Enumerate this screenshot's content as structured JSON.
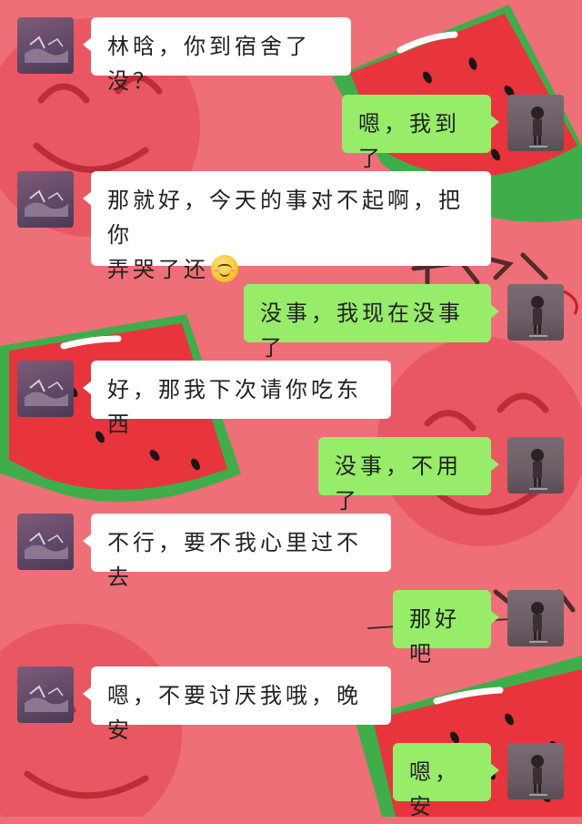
{
  "chat": {
    "messages": [
      {
        "sender": "friend",
        "text": "林晗，你到宿舍了没？"
      },
      {
        "sender": "me",
        "text": "嗯，我到了"
      },
      {
        "sender": "friend",
        "line1": "那就好，今天的事对不起啊，把你",
        "line2": "弄哭了还",
        "emoji": "smiling-face-emoji"
      },
      {
        "sender": "me",
        "text": "没事，我现在没事了"
      },
      {
        "sender": "friend",
        "text": "好，那我下次请你吃东西"
      },
      {
        "sender": "me",
        "text": "没事，不用了"
      },
      {
        "sender": "friend",
        "text": "不行，要不我心里过不去"
      },
      {
        "sender": "me",
        "text": "那好吧"
      },
      {
        "sender": "friend",
        "text": "嗯，不要讨厌我哦，晚安"
      },
      {
        "sender": "me",
        "text": "嗯，安"
      }
    ]
  },
  "colors": {
    "background": "#ee6f78",
    "friend_bubble": "#ffffff",
    "my_bubble": "#97ec6a",
    "watermelon_flesh": "#e8343c",
    "watermelon_rind": "#3fae4a"
  }
}
